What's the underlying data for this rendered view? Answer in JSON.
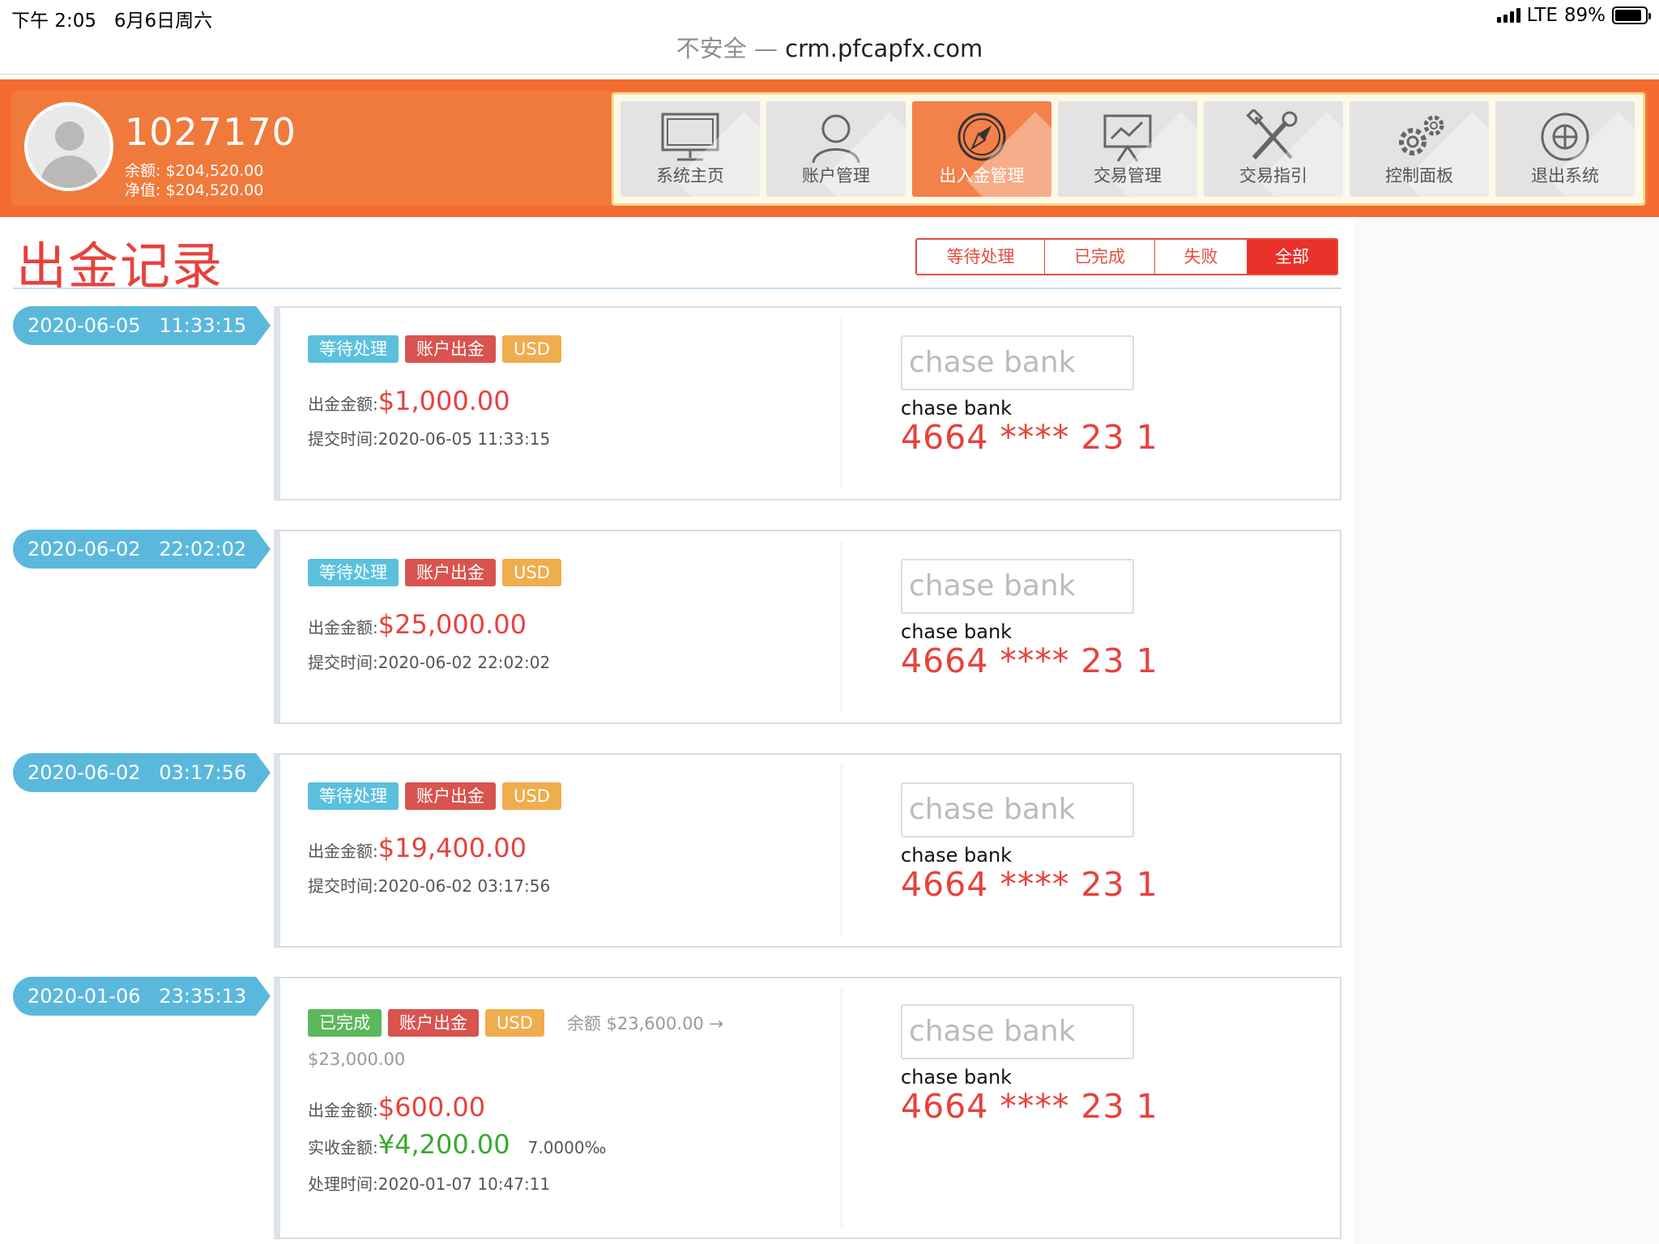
{
  "status_bar": {
    "time": "下午 2:05",
    "date": "6月6日周六",
    "network": "LTE",
    "battery": "89%",
    "battery_level": 0.89
  },
  "url_bar": {
    "security": "不安全",
    "separator": "—",
    "host": "crm.pfcapfx.com"
  },
  "account": {
    "id": "1027170",
    "balance_label": "余额:",
    "balance_value": "$204,520.00",
    "equity_label": "净值:",
    "equity_value": "$204,520.00"
  },
  "nav": {
    "items": [
      {
        "label": "系统主页",
        "icon": "monitor-icon"
      },
      {
        "label": "账户管理",
        "icon": "user-icon"
      },
      {
        "label": "出入金管理",
        "icon": "compass-icon",
        "active": true
      },
      {
        "label": "交易管理",
        "icon": "chart-board-icon"
      },
      {
        "label": "交易指引",
        "icon": "tools-icon"
      },
      {
        "label": "控制面板",
        "icon": "gears-icon"
      },
      {
        "label": "退出系统",
        "icon": "power-icon"
      }
    ]
  },
  "page": {
    "title": "出金记录"
  },
  "filter": {
    "pending": "等待处理",
    "completed": "已完成",
    "failed": "失败",
    "all": "全部",
    "active": "all"
  },
  "colors": {
    "header_orange": "#f36b2f",
    "red": "#e8413c",
    "timeline_blue": "#5bb8dd",
    "green": "#3aa82f"
  },
  "records": [
    {
      "date": "2020-06-05",
      "time": "11:33:15",
      "status_tag": "等待处理",
      "type_tag": "账户出金",
      "currency_tag": "USD",
      "amount_label": "出金金额:",
      "amount": "$1,000.00",
      "time_label": "提交时间:",
      "time_value": "2020-06-05 11:33:15",
      "bank_placeholder": "chase bank",
      "bank_name": "chase bank",
      "card_number": "4664 **** 23 1"
    },
    {
      "date": "2020-06-02",
      "time": "22:02:02",
      "status_tag": "等待处理",
      "type_tag": "账户出金",
      "currency_tag": "USD",
      "amount_label": "出金金额:",
      "amount": "$25,000.00",
      "time_label": "提交时间:",
      "time_value": "2020-06-02 22:02:02",
      "bank_placeholder": "chase bank",
      "bank_name": "chase bank",
      "card_number": "4664 **** 23 1"
    },
    {
      "date": "2020-06-02",
      "time": "03:17:56",
      "status_tag": "等待处理",
      "type_tag": "账户出金",
      "currency_tag": "USD",
      "amount_label": "出金金额:",
      "amount": "$19,400.00",
      "time_label": "提交时间:",
      "time_value": "2020-06-02 03:17:56",
      "bank_placeholder": "chase bank",
      "bank_name": "chase bank",
      "card_number": "4664 **** 23 1"
    },
    {
      "date": "2020-01-06",
      "time": "23:35:13",
      "status_tag": "已完成",
      "type_tag": "账户出金",
      "currency_tag": "USD",
      "balance_note": "余额 $23,600.00 →",
      "balance_after": "$23,000.00",
      "amount_label": "出金金额:",
      "amount": "$600.00",
      "received_label": "实收金额:",
      "received": "¥4,200.00",
      "rate": "7.0000‰",
      "time_label": "处理时间:",
      "time_value": "2020-01-07 10:47:11",
      "bank_placeholder": "chase bank",
      "bank_name": "chase bank",
      "card_number": "4664 **** 23 1"
    }
  ]
}
